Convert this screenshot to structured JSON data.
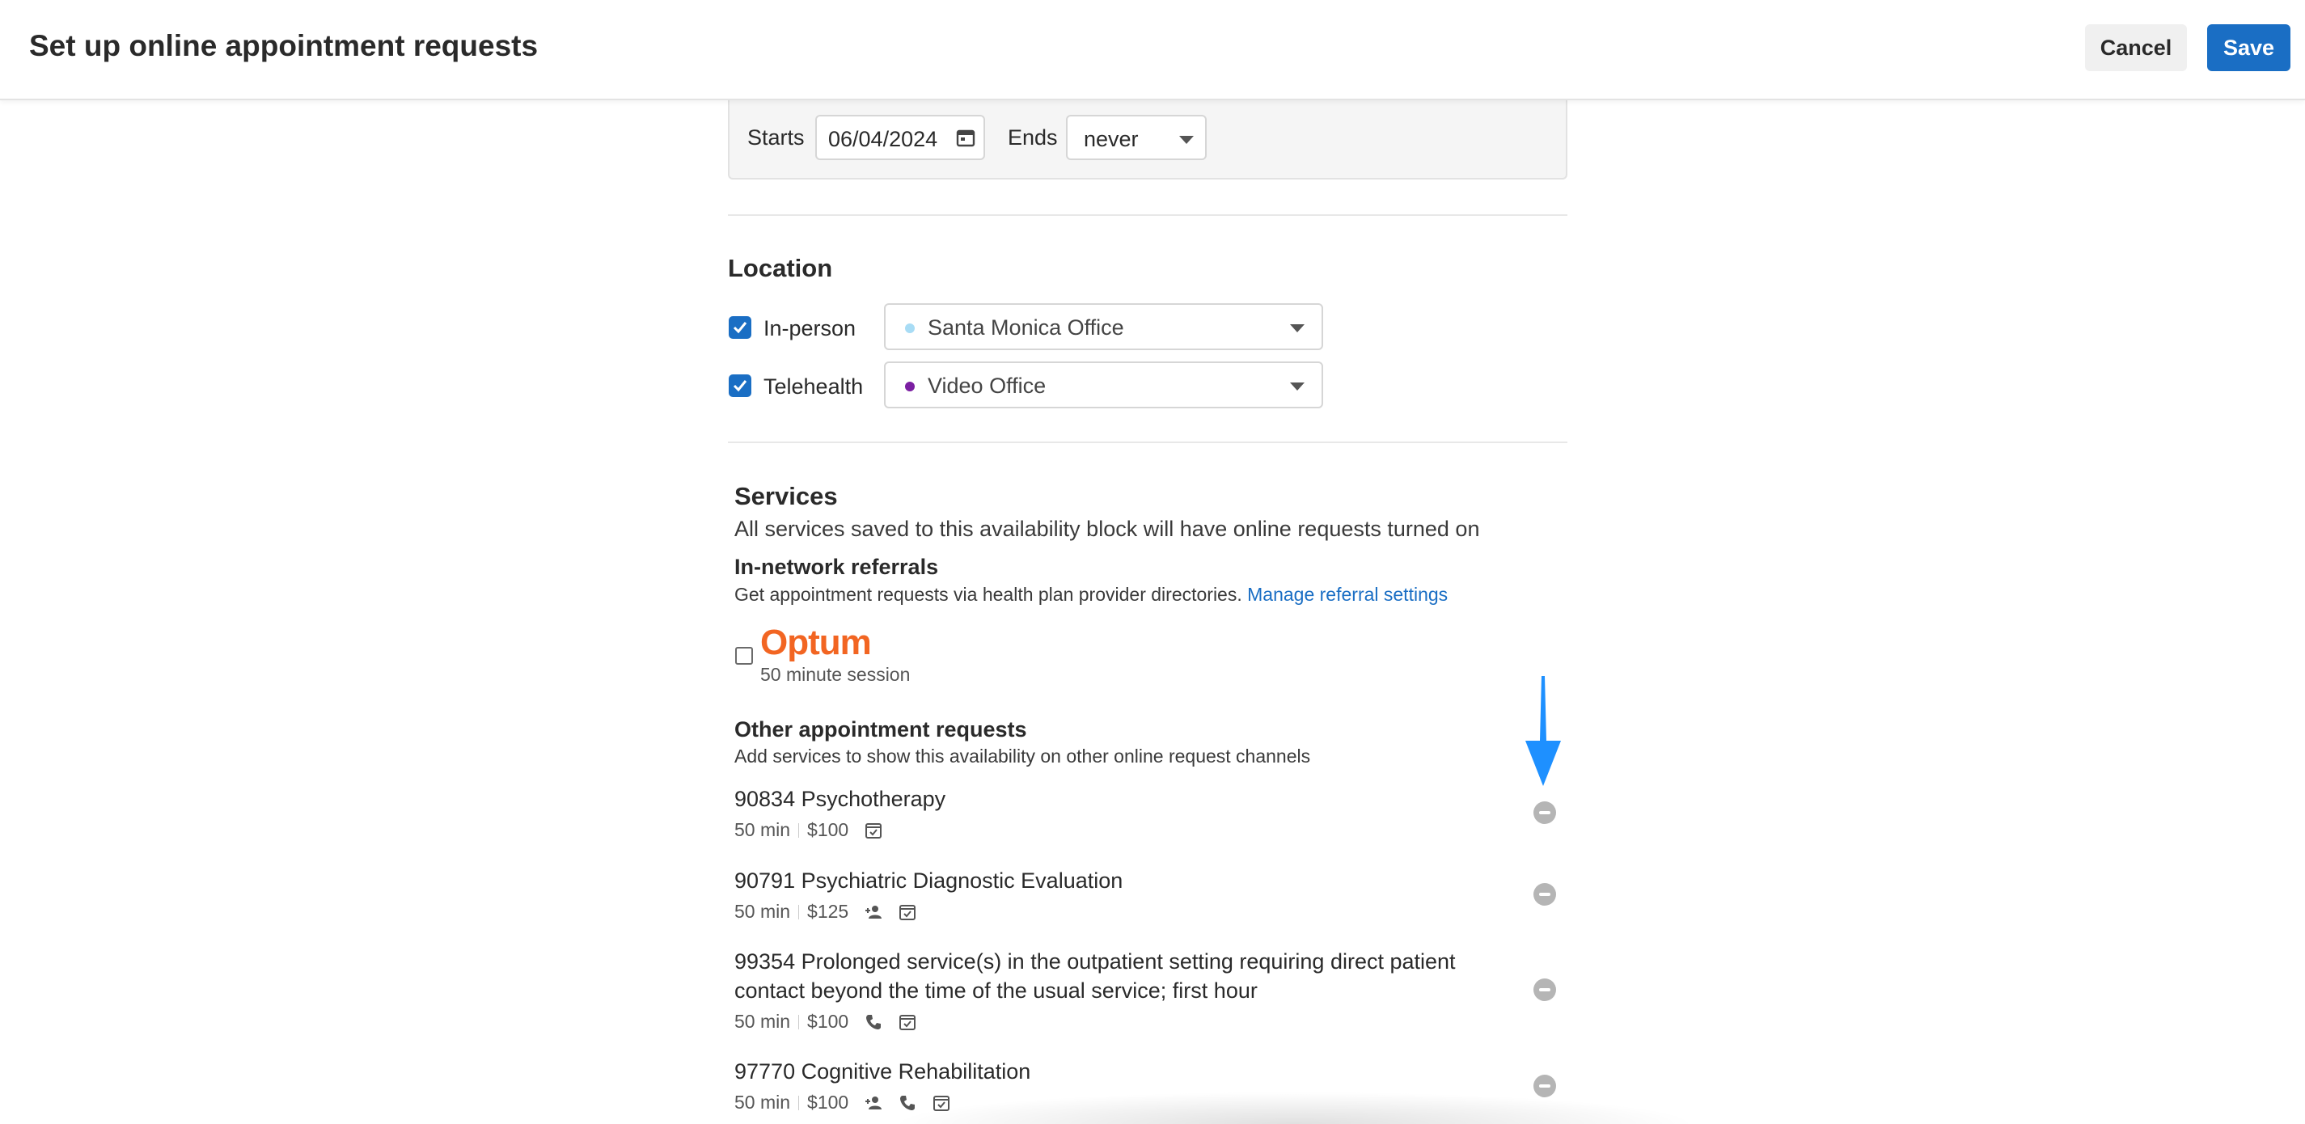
{
  "header": {
    "title": "Set up online appointment requests",
    "cancel_label": "Cancel",
    "save_label": "Save"
  },
  "recurrence": {
    "starts_label": "Starts",
    "start_date": "06/04/2024",
    "ends_label": "Ends",
    "ends_value": "never"
  },
  "location": {
    "title": "Location",
    "in_person": {
      "label": "In-person",
      "checked": true,
      "office": "Santa Monica Office",
      "dot_color": "#a8dcf5"
    },
    "telehealth": {
      "label": "Telehealth",
      "checked": true,
      "office": "Video Office",
      "dot_color": "#7b1fa2"
    }
  },
  "services": {
    "title": "Services",
    "description": "All services saved to this availability block will have online requests turned on",
    "referrals": {
      "title": "In-network referrals",
      "description": "Get appointment requests via health plan provider directories.",
      "link": "Manage referral settings",
      "optum": {
        "logo_text": "Optum",
        "session": "50 minute session",
        "checked": false
      }
    },
    "other": {
      "title": "Other appointment requests",
      "description": "Add services to show this availability on other online request channels",
      "items": [
        {
          "name": "90834 Psychotherapy",
          "duration": "50 min",
          "price": "$100",
          "icons": [
            "calendar-check-icon"
          ]
        },
        {
          "name": "90791 Psychiatric Diagnostic Evaluation",
          "duration": "50 min",
          "price": "$125",
          "icons": [
            "person-add-icon",
            "calendar-check-icon"
          ]
        },
        {
          "name_line1": "99354 Prolonged service(s) in the outpatient setting requiring direct patient",
          "name_line2": "contact beyond the time of the usual service; first hour",
          "duration": "50 min",
          "price": "$100",
          "icons": [
            "phone-icon",
            "calendar-check-icon"
          ]
        },
        {
          "name": "97770 Cognitive Rehabilitation",
          "duration": "50 min",
          "price": "$100",
          "icons": [
            "person-add-icon",
            "phone-icon",
            "calendar-check-icon"
          ]
        }
      ]
    }
  },
  "colors": {
    "primary": "#1a6ec4",
    "optum": "#f26522",
    "annotation_arrow": "#1e90ff"
  }
}
